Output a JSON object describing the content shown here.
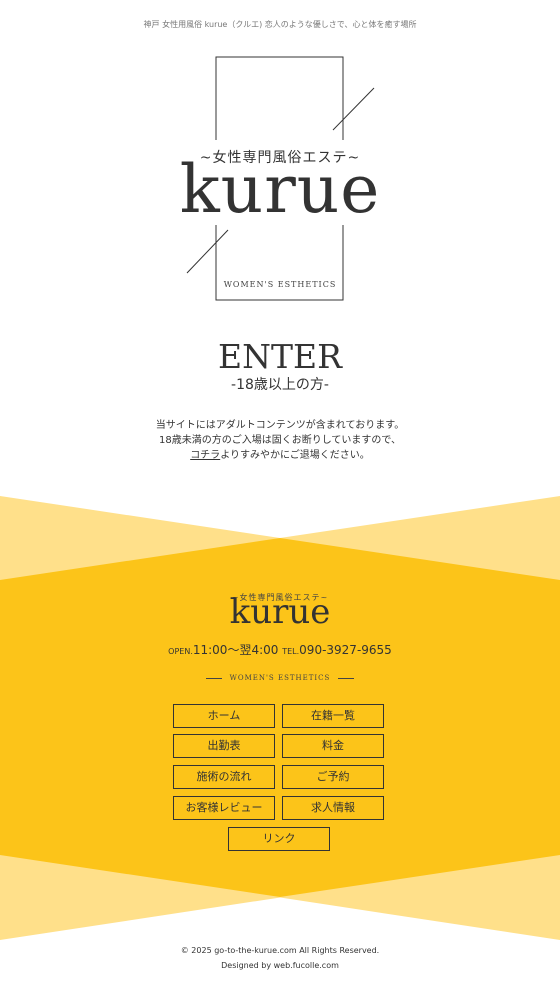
{
  "tagline": "神戸 女性用風俗 kurue（クルエ) 恋人のような優しさで、心と体を癒す場所",
  "hero": {
    "subtitle": "~女性専門風俗エステ~",
    "logo": "kurue",
    "womens": "WOMEN'S ESTHETICS"
  },
  "enter": {
    "label": "ENTER",
    "age": "-18歳以上の方-"
  },
  "notice": {
    "line1": "当サイトにはアダルトコンテンツが含まれております。",
    "line2": "18歳未満の方のご入場は固くお断りしていますので、",
    "link": "コチラ",
    "line3_rest": "よりすみやかにご退場ください。"
  },
  "footer": {
    "subtitle": "~女性専門風俗エステ~",
    "logo": "kurue",
    "open_label": "OPEN.",
    "open_hours": "11:00～翌4:00",
    "tel_label": "TEL.",
    "tel": "090-3927-9655",
    "womens": "WOMEN'S ESTHETICS"
  },
  "nav": {
    "home": "ホーム",
    "cast": "在籍一覧",
    "schedule": "出勤表",
    "price": "料金",
    "flow": "施術の流れ",
    "reserve": "ご予約",
    "review": "お客様レビュー",
    "recruit": "求人情報",
    "link": "リンク"
  },
  "copyright": "© 2025 go-to-the-kurue.com All Rights Reserved.",
  "designed_by": "Designed by web.fucolle.com",
  "colors": {
    "yellow": "#fcc419",
    "yellow_light": "#ffe08a",
    "text": "#333333"
  }
}
